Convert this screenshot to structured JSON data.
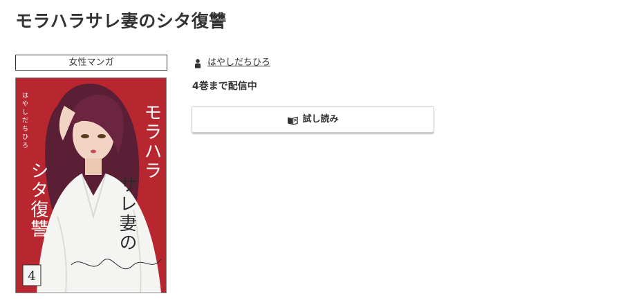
{
  "title": "モラハラサレ妻のシタ復讐",
  "genre": "女性マンガ",
  "cover": {
    "title_text": "モラハラサレ妻のシタ復讐",
    "author_text": "はやしだちひろ",
    "volume_number": "4",
    "background_color": "#b8262f"
  },
  "author": {
    "icon": "person-icon",
    "name": "はやしだちひろ"
  },
  "volume_status": "4巻まで配信中",
  "trial_button": {
    "icon": "book-icon",
    "label": "試し読み"
  }
}
